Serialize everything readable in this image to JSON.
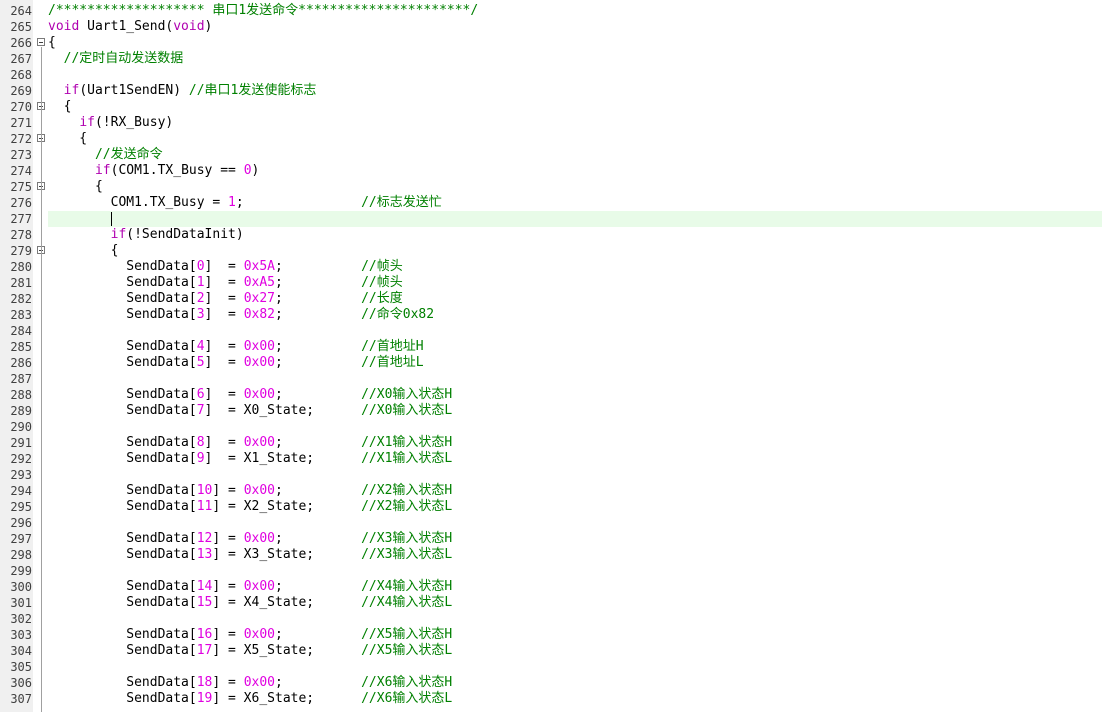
{
  "editor": {
    "lines": [
      {
        "n": "264",
        "fold": "",
        "tokens": [
          [
            "cm",
            "/******************* 串口1发送命令**********************/"
          ]
        ]
      },
      {
        "n": "265",
        "fold": "",
        "tokens": [
          [
            "kw",
            "void"
          ],
          [
            "tx",
            " Uart1_Send("
          ],
          [
            "kw",
            "void"
          ],
          [
            "tx",
            ")"
          ]
        ]
      },
      {
        "n": "266",
        "fold": "minus",
        "tokens": [
          [
            "tx",
            "{"
          ]
        ]
      },
      {
        "n": "267",
        "fold": "",
        "tokens": [
          [
            "tx",
            "  "
          ],
          [
            "cm",
            "//定时自动发送数据"
          ]
        ]
      },
      {
        "n": "268",
        "fold": "",
        "tokens": []
      },
      {
        "n": "269",
        "fold": "",
        "tokens": [
          [
            "tx",
            "  "
          ],
          [
            "kw",
            "if"
          ],
          [
            "tx",
            "(Uart1SendEN) "
          ],
          [
            "cm",
            "//串口1发送使能标志"
          ]
        ]
      },
      {
        "n": "270",
        "fold": "minus",
        "tokens": [
          [
            "tx",
            "  {"
          ]
        ]
      },
      {
        "n": "271",
        "fold": "",
        "tokens": [
          [
            "tx",
            "    "
          ],
          [
            "kw",
            "if"
          ],
          [
            "tx",
            "(!RX_Busy)"
          ]
        ]
      },
      {
        "n": "272",
        "fold": "minus",
        "tokens": [
          [
            "tx",
            "    {"
          ]
        ]
      },
      {
        "n": "273",
        "fold": "",
        "tokens": [
          [
            "tx",
            "      "
          ],
          [
            "cm",
            "//发送命令"
          ]
        ]
      },
      {
        "n": "274",
        "fold": "",
        "tokens": [
          [
            "tx",
            "      "
          ],
          [
            "kw",
            "if"
          ],
          [
            "tx",
            "(COM1.TX_Busy == "
          ],
          [
            "num",
            "0"
          ],
          [
            "tx",
            ")"
          ]
        ]
      },
      {
        "n": "275",
        "fold": "minus",
        "tokens": [
          [
            "tx",
            "      {"
          ]
        ]
      },
      {
        "n": "276",
        "fold": "",
        "tokens": [
          [
            "tx",
            "        COM1.TX_Busy = "
          ],
          [
            "num",
            "1"
          ],
          [
            "tx",
            ";               "
          ],
          [
            "cm",
            "//标志发送忙"
          ]
        ]
      },
      {
        "n": "277",
        "fold": "",
        "current": true,
        "tokens": [
          [
            "tx",
            "        "
          ],
          [
            "caret",
            ""
          ]
        ]
      },
      {
        "n": "278",
        "fold": "",
        "tokens": [
          [
            "tx",
            "        "
          ],
          [
            "kw",
            "if"
          ],
          [
            "tx",
            "(!SendDataInit)"
          ]
        ]
      },
      {
        "n": "279",
        "fold": "minus",
        "tokens": [
          [
            "tx",
            "        {"
          ]
        ]
      },
      {
        "n": "280",
        "fold": "",
        "tokens": [
          [
            "tx",
            "          SendData["
          ],
          [
            "num",
            "0"
          ],
          [
            "tx",
            "]  = "
          ],
          [
            "num",
            "0x5A"
          ],
          [
            "tx",
            ";          "
          ],
          [
            "cm",
            "//帧头"
          ]
        ]
      },
      {
        "n": "281",
        "fold": "",
        "tokens": [
          [
            "tx",
            "          SendData["
          ],
          [
            "num",
            "1"
          ],
          [
            "tx",
            "]  = "
          ],
          [
            "num",
            "0xA5"
          ],
          [
            "tx",
            ";          "
          ],
          [
            "cm",
            "//帧头"
          ]
        ]
      },
      {
        "n": "282",
        "fold": "",
        "tokens": [
          [
            "tx",
            "          SendData["
          ],
          [
            "num",
            "2"
          ],
          [
            "tx",
            "]  = "
          ],
          [
            "num",
            "0x27"
          ],
          [
            "tx",
            ";          "
          ],
          [
            "cm",
            "//长度"
          ]
        ]
      },
      {
        "n": "283",
        "fold": "",
        "tokens": [
          [
            "tx",
            "          SendData["
          ],
          [
            "num",
            "3"
          ],
          [
            "tx",
            "]  = "
          ],
          [
            "num",
            "0x82"
          ],
          [
            "tx",
            ";          "
          ],
          [
            "cm",
            "//命令0x82"
          ]
        ]
      },
      {
        "n": "284",
        "fold": "",
        "tokens": []
      },
      {
        "n": "285",
        "fold": "",
        "tokens": [
          [
            "tx",
            "          SendData["
          ],
          [
            "num",
            "4"
          ],
          [
            "tx",
            "]  = "
          ],
          [
            "num",
            "0x00"
          ],
          [
            "tx",
            ";          "
          ],
          [
            "cm",
            "//首地址H"
          ]
        ]
      },
      {
        "n": "286",
        "fold": "",
        "tokens": [
          [
            "tx",
            "          SendData["
          ],
          [
            "num",
            "5"
          ],
          [
            "tx",
            "]  = "
          ],
          [
            "num",
            "0x00"
          ],
          [
            "tx",
            ";          "
          ],
          [
            "cm",
            "//首地址L"
          ]
        ]
      },
      {
        "n": "287",
        "fold": "",
        "tokens": []
      },
      {
        "n": "288",
        "fold": "",
        "tokens": [
          [
            "tx",
            "          SendData["
          ],
          [
            "num",
            "6"
          ],
          [
            "tx",
            "]  = "
          ],
          [
            "num",
            "0x00"
          ],
          [
            "tx",
            ";          "
          ],
          [
            "cm",
            "//X0输入状态H"
          ]
        ]
      },
      {
        "n": "289",
        "fold": "",
        "tokens": [
          [
            "tx",
            "          SendData["
          ],
          [
            "num",
            "7"
          ],
          [
            "tx",
            "]  = X0_State;      "
          ],
          [
            "cm",
            "//X0输入状态L"
          ]
        ]
      },
      {
        "n": "290",
        "fold": "",
        "tokens": []
      },
      {
        "n": "291",
        "fold": "",
        "tokens": [
          [
            "tx",
            "          SendData["
          ],
          [
            "num",
            "8"
          ],
          [
            "tx",
            "]  = "
          ],
          [
            "num",
            "0x00"
          ],
          [
            "tx",
            ";          "
          ],
          [
            "cm",
            "//X1输入状态H"
          ]
        ]
      },
      {
        "n": "292",
        "fold": "",
        "tokens": [
          [
            "tx",
            "          SendData["
          ],
          [
            "num",
            "9"
          ],
          [
            "tx",
            "]  = X1_State;      "
          ],
          [
            "cm",
            "//X1输入状态L"
          ]
        ]
      },
      {
        "n": "293",
        "fold": "",
        "tokens": []
      },
      {
        "n": "294",
        "fold": "",
        "tokens": [
          [
            "tx",
            "          SendData["
          ],
          [
            "num",
            "10"
          ],
          [
            "tx",
            "] = "
          ],
          [
            "num",
            "0x00"
          ],
          [
            "tx",
            ";          "
          ],
          [
            "cm",
            "//X2输入状态H"
          ]
        ]
      },
      {
        "n": "295",
        "fold": "",
        "tokens": [
          [
            "tx",
            "          SendData["
          ],
          [
            "num",
            "11"
          ],
          [
            "tx",
            "] = X2_State;      "
          ],
          [
            "cm",
            "//X2输入状态L"
          ]
        ]
      },
      {
        "n": "296",
        "fold": "",
        "tokens": []
      },
      {
        "n": "297",
        "fold": "",
        "tokens": [
          [
            "tx",
            "          SendData["
          ],
          [
            "num",
            "12"
          ],
          [
            "tx",
            "] = "
          ],
          [
            "num",
            "0x00"
          ],
          [
            "tx",
            ";          "
          ],
          [
            "cm",
            "//X3输入状态H"
          ]
        ]
      },
      {
        "n": "298",
        "fold": "",
        "tokens": [
          [
            "tx",
            "          SendData["
          ],
          [
            "num",
            "13"
          ],
          [
            "tx",
            "] = X3_State;      "
          ],
          [
            "cm",
            "//X3输入状态L"
          ]
        ]
      },
      {
        "n": "299",
        "fold": "",
        "tokens": []
      },
      {
        "n": "300",
        "fold": "",
        "tokens": [
          [
            "tx",
            "          SendData["
          ],
          [
            "num",
            "14"
          ],
          [
            "tx",
            "] = "
          ],
          [
            "num",
            "0x00"
          ],
          [
            "tx",
            ";          "
          ],
          [
            "cm",
            "//X4输入状态H"
          ]
        ]
      },
      {
        "n": "301",
        "fold": "",
        "tokens": [
          [
            "tx",
            "          SendData["
          ],
          [
            "num",
            "15"
          ],
          [
            "tx",
            "] = X4_State;      "
          ],
          [
            "cm",
            "//X4输入状态L"
          ]
        ]
      },
      {
        "n": "302",
        "fold": "",
        "tokens": []
      },
      {
        "n": "303",
        "fold": "",
        "tokens": [
          [
            "tx",
            "          SendData["
          ],
          [
            "num",
            "16"
          ],
          [
            "tx",
            "] = "
          ],
          [
            "num",
            "0x00"
          ],
          [
            "tx",
            ";          "
          ],
          [
            "cm",
            "//X5输入状态H"
          ]
        ]
      },
      {
        "n": "304",
        "fold": "",
        "tokens": [
          [
            "tx",
            "          SendData["
          ],
          [
            "num",
            "17"
          ],
          [
            "tx",
            "] = X5_State;      "
          ],
          [
            "cm",
            "//X5输入状态L"
          ]
        ]
      },
      {
        "n": "305",
        "fold": "",
        "tokens": []
      },
      {
        "n": "306",
        "fold": "",
        "tokens": [
          [
            "tx",
            "          SendData["
          ],
          [
            "num",
            "18"
          ],
          [
            "tx",
            "] = "
          ],
          [
            "num",
            "0x00"
          ],
          [
            "tx",
            ";          "
          ],
          [
            "cm",
            "//X6输入状态H"
          ]
        ]
      },
      {
        "n": "307",
        "fold": "",
        "tokens": [
          [
            "tx",
            "          SendData["
          ],
          [
            "num",
            "19"
          ],
          [
            "tx",
            "] = X6_State;      "
          ],
          [
            "cm",
            "//X6输入状态L"
          ]
        ]
      }
    ]
  },
  "colors": {
    "keyword": "#b000b0",
    "number": "#e000e0",
    "comment": "#008000",
    "current_line": "#e8fbe8",
    "gutter": "#f0f0f0"
  }
}
